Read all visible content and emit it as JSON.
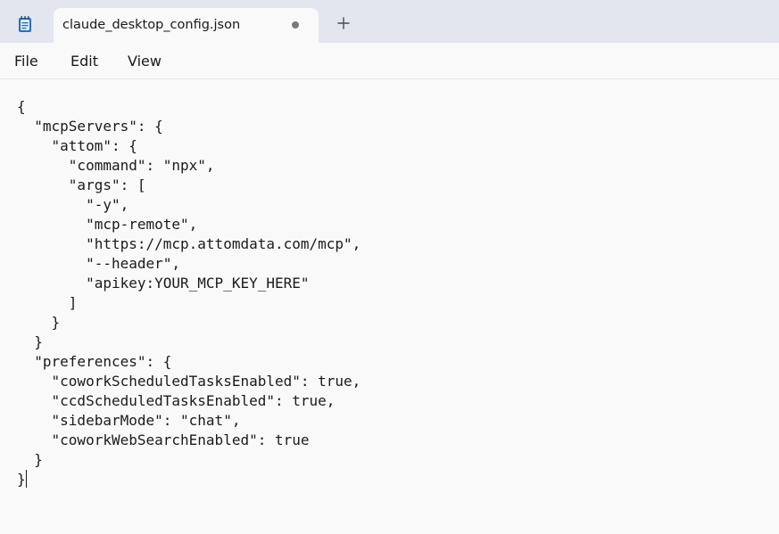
{
  "window": {
    "app_icon": "notepad-icon",
    "tab": {
      "title": "claude_desktop_config.json",
      "modified_indicator": "unsaved-dot-icon"
    },
    "new_tab_icon": "plus-icon"
  },
  "menu": {
    "file": "File",
    "edit": "Edit",
    "view": "View"
  },
  "editor": {
    "content": "{\n  \"mcpServers\": {\n    \"attom\": {\n      \"command\": \"npx\",\n      \"args\": [\n        \"-y\",\n        \"mcp-remote\",\n        \"https://mcp.attomdata.com/mcp\",\n        \"--header\",\n        \"apikey:YOUR_MCP_KEY_HERE\"\n      ]\n    }\n  }\n  \"preferences\": {\n    \"coworkScheduledTasksEnabled\": true,\n    \"ccdScheduledTasksEnabled\": true,\n    \"sidebarMode\": \"chat\",\n    \"coworkWebSearchEnabled\": true\n  }\n}"
  },
  "colors": {
    "titlebar": "#e3e6ee",
    "background": "#f9f9f9",
    "text": "#1b1b1b"
  }
}
